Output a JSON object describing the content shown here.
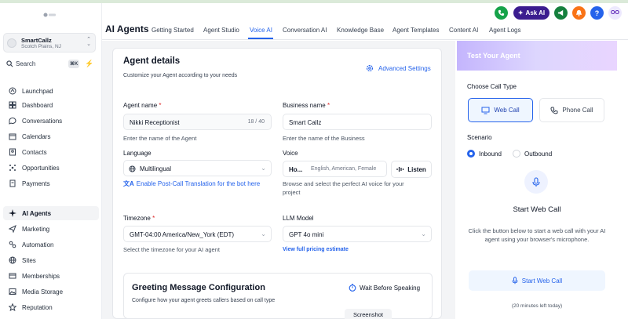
{
  "account": {
    "name": "SmartCallz",
    "location": "Scotch Plains, NJ"
  },
  "search": {
    "label": "Search",
    "shortcut": "⌘K"
  },
  "nav": [
    {
      "label": "Launchpad",
      "icon": "launchpad-icon"
    },
    {
      "label": "Dashboard",
      "icon": "dashboard-icon"
    },
    {
      "label": "Conversations",
      "icon": "chat-bubble-icon"
    },
    {
      "label": "Calendars",
      "icon": "calendar-icon"
    },
    {
      "label": "Contacts",
      "icon": "contacts-icon"
    },
    {
      "label": "Opportunities",
      "icon": "opportunities-icon"
    },
    {
      "label": "Payments",
      "icon": "payments-icon"
    },
    {
      "label": "AI Agents",
      "icon": "sparkle-icon",
      "active": true
    },
    {
      "label": "Marketing",
      "icon": "send-icon"
    },
    {
      "label": "Automation",
      "icon": "automation-icon"
    },
    {
      "label": "Sites",
      "icon": "globe-icon"
    },
    {
      "label": "Memberships",
      "icon": "memberships-icon"
    },
    {
      "label": "Media Storage",
      "icon": "image-icon"
    },
    {
      "label": "Reputation",
      "icon": "star-icon"
    }
  ],
  "header": {
    "title": "AI Agents",
    "tabs": [
      "Getting Started",
      "Agent Studio",
      "Voice AI",
      "Conversation AI",
      "Knowledge Base",
      "Agent Templates",
      "Content AI",
      "Agent Logs"
    ],
    "active_tab": "Voice AI",
    "ask_ai": "Ask AI",
    "help": "?",
    "avatar": "OO"
  },
  "agent": {
    "title": "Agent details",
    "subtitle": "Customize your Agent according to your needs",
    "advanced": "Advanced Settings",
    "agent_name_label": "Agent name",
    "agent_name_value": "Nikki Receptionist",
    "agent_name_count": "18 / 40",
    "agent_name_hint": "Enter the name of the Agent",
    "business_label": "Business name",
    "business_value": "Smart Callz",
    "business_hint": "Enter the name of the Business",
    "language_label": "Language",
    "language_value": "Multilingual",
    "translation_link": "Enable Post-Call Translation for the bot here",
    "voice_label": "Voice",
    "voice_value": "Ho...",
    "voice_desc": "English, American, Female",
    "listen": "Listen",
    "voice_hint_1": "Browse and select the perfect AI voice for your",
    "voice_hint_2": "project",
    "timezone_label": "Timezone",
    "timezone_value": "GMT-04:00 America/New_York (EDT)",
    "timezone_hint": "Select the timezone for your AI agent",
    "llm_label": "LLM Model",
    "llm_value": "GPT 4o mini",
    "pricing_link": "View full pricing estimate",
    "required": "*"
  },
  "greeting": {
    "title": "Greeting Message Configuration",
    "subtitle": "Configure how your agent greets callers based on call type",
    "wait": "Wait Before Speaking"
  },
  "test": {
    "title": "Test Your Agent",
    "call_type_label": "Choose Call Type",
    "web_call": "Web Call",
    "phone_call": "Phone Call",
    "scenario_label": "Scenario",
    "inbound": "Inbound",
    "outbound": "Outbound",
    "start_title": "Start Web Call",
    "start_desc": "Click the button below to start a web call with your AI agent using your browser's microphone.",
    "start_button": "Start Web Call",
    "minutes": "(20 minutes left today)"
  },
  "screenshot_label": "Screenshot",
  "colors": {
    "accent": "#2563eb",
    "askai": "#3b1d8f",
    "phone": "#16a34a",
    "megaphone": "#15803d",
    "bell": "#f97316",
    "help": "#2563eb",
    "avatar": "#ede9fe"
  }
}
